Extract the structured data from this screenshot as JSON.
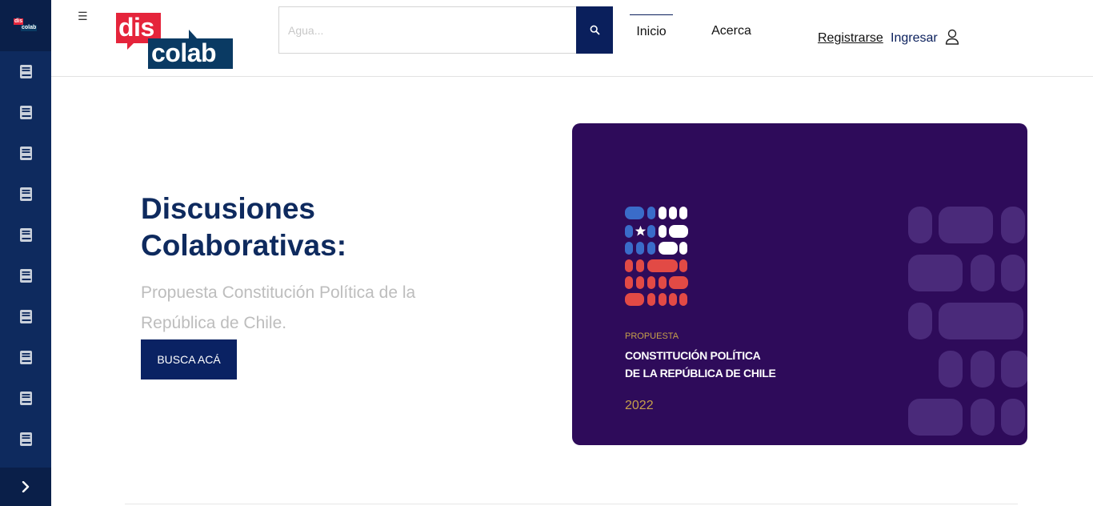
{
  "sidebar": {
    "logo": {
      "dis": "dis",
      "colab": "colab"
    },
    "items": [
      {
        "icon": "book-icon"
      },
      {
        "icon": "book-icon"
      },
      {
        "icon": "book-icon"
      },
      {
        "icon": "book-icon"
      },
      {
        "icon": "book-icon"
      },
      {
        "icon": "book-icon"
      },
      {
        "icon": "book-icon"
      },
      {
        "icon": "book-icon"
      },
      {
        "icon": "book-icon"
      },
      {
        "icon": "book-icon"
      }
    ],
    "expand_icon": "chevron-right-icon"
  },
  "header": {
    "menu_icon": "☰",
    "logo": {
      "dis": "dis",
      "colab": "colab"
    },
    "search": {
      "placeholder": "Agua...",
      "value": ""
    },
    "nav": {
      "inicio": "Inicio",
      "acerca": "Acerca"
    },
    "registrarse": "Registrarse",
    "ingresar": "Ingresar"
  },
  "hero": {
    "title": "Discusiones Colaborativas:",
    "subtitle": "Propuesta Constitución Política de la República de Chile.",
    "button": "BUSCA ACÁ",
    "cover": {
      "label": "PROPUESTA",
      "title_line1": "CONSTITUCIÓN POLÍTICA",
      "title_line2": "DE LA REPÚBLICA DE CHILE",
      "year": "2022"
    }
  },
  "colors": {
    "sidebar": "#0e2a5e",
    "brand_red": "#e5243b",
    "brand_navy": "#0a3a63",
    "button": "#0a2263",
    "cover_bg": "#2e0b5a",
    "cover_gold": "#c6a04a"
  }
}
